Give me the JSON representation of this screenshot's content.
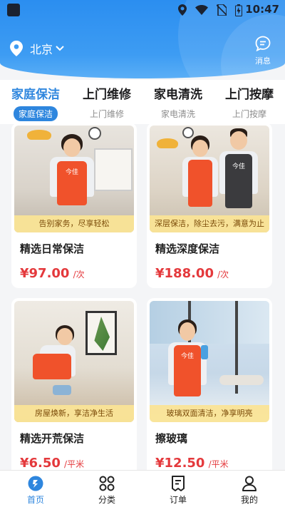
{
  "status_bar": {
    "time": "10:47"
  },
  "header": {
    "city": "北京",
    "message_label": "消息"
  },
  "tabs": [
    {
      "title": "家庭保洁",
      "subtitle": "家庭保洁"
    },
    {
      "title": "上门维修",
      "subtitle": "上门维修"
    },
    {
      "title": "家电清洗",
      "subtitle": "家电清洗"
    },
    {
      "title": "上门按摩",
      "subtitle": "上门按摩"
    }
  ],
  "products": [
    {
      "banner": "告别家务，尽享轻松",
      "title": "精选日常保洁",
      "price": "¥97.00",
      "unit": "/次"
    },
    {
      "banner": "深层保洁，除尘去污，满意为止",
      "title": "精选深度保洁",
      "price": "¥188.00",
      "unit": "/次"
    },
    {
      "banner": "房屋焕新，享洁净生活",
      "title": "精选开荒保洁",
      "price": "¥6.50",
      "unit": "/平米"
    },
    {
      "banner": "玻璃双面清洁，净享明亮",
      "title": "擦玻璃",
      "price": "¥12.50",
      "unit": "/平米"
    }
  ],
  "apron_text": "今佳",
  "bottom_nav": [
    {
      "label": "首页",
      "icon": "home-icon"
    },
    {
      "label": "分类",
      "icon": "category-icon"
    },
    {
      "label": "订单",
      "icon": "order-icon"
    },
    {
      "label": "我的",
      "icon": "profile-icon"
    }
  ],
  "colors": {
    "primary": "#2e86de",
    "price": "#e4393c",
    "header": "#3d9cf3"
  }
}
